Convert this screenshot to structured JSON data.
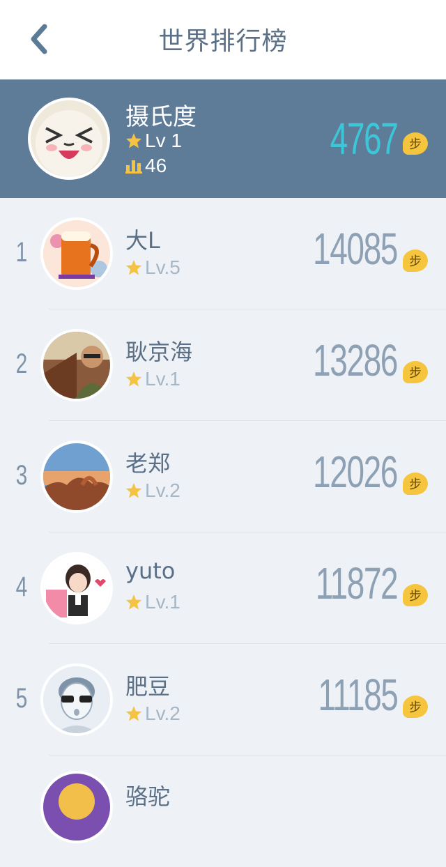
{
  "header": {
    "title": "世界排行榜",
    "back_icon": "chevron-left-icon"
  },
  "me": {
    "name": "摄氏度",
    "level": "Lv 1",
    "rank": "46",
    "steps": "4767",
    "step_unit": "步"
  },
  "ranking": [
    {
      "rank": "1",
      "name": "大L",
      "level": "Lv.5",
      "steps": "14085",
      "step_unit": "步"
    },
    {
      "rank": "2",
      "name": "耿京海",
      "level": "Lv.1",
      "steps": "13286",
      "step_unit": "步"
    },
    {
      "rank": "3",
      "name": "老郑",
      "level": "Lv.2",
      "steps": "12026",
      "step_unit": "步"
    },
    {
      "rank": "4",
      "name": "yuto",
      "level": "Lv.1",
      "steps": "11872",
      "step_unit": "步"
    },
    {
      "rank": "5",
      "name": "肥豆",
      "level": "Lv.2",
      "steps": "11185",
      "step_unit": "步"
    },
    {
      "rank": "",
      "name": "骆驼",
      "level": "",
      "steps": "",
      "step_unit": ""
    }
  ],
  "colors": {
    "header_bg": "#ffffff",
    "me_bg": "#5e7b97",
    "list_bg": "#eef2f6",
    "accent_steps": "#3cc7d9",
    "badge": "#f6c53e",
    "star": "#f5c342"
  }
}
